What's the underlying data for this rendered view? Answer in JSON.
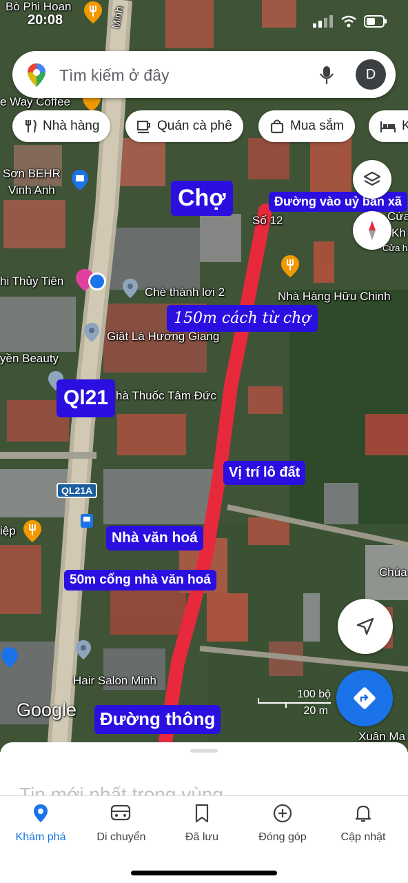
{
  "status": {
    "time": "20:08"
  },
  "search": {
    "placeholder": "Tìm kiếm ở đây",
    "avatar_letter": "D"
  },
  "chips": [
    {
      "label": "Nhà hàng",
      "icon": "fork-knife-icon"
    },
    {
      "label": "Quán cà phê",
      "icon": "coffee-cup-icon"
    },
    {
      "label": "Mua sắm",
      "icon": "shopping-bag-icon"
    },
    {
      "label": "K",
      "icon": "bed-icon"
    }
  ],
  "map_places": {
    "bo_phi_hoan": "Bò Phi Hoan",
    "way_coffee": "e Way Coffee",
    "son_behr_1": "Sơn BEHR",
    "son_behr_2": "Vinh Anh",
    "thuy_tien": "hi Thủy Tiên",
    "che_thanh_loi": "Chè thành lơi 2",
    "giat_la": "Giặt Là Hương Giang",
    "beauty": "yền Beauty",
    "nha_thuoc": "hà Thuốc Tâm Đức",
    "so_12": "Số 12",
    "cua": "Cửa",
    "kh": "Kh",
    "cua_hang": "Cửa hà",
    "nha_hang_huu_chinh": "Nhà Hàng Hữu Chinh",
    "road_ql21a": "QL21A",
    "hiep": "iệp",
    "chua": "Chùa",
    "hair_salon": "Hair Salon Minh",
    "xuan_ma": "Xuân Ma",
    "road_minh": "Minh",
    "google_logo": "Google",
    "scale_top": "100 bộ",
    "scale_bottom": "20 m"
  },
  "annotations": {
    "cho": "Chợ",
    "duong_vao": "Đường vào uỷ ban xã",
    "cach_cho": "150m cách từ chợ",
    "ql21": "Ql21",
    "vi_tri": "Vị trí lô đất",
    "nha_van_hoa": "Nhà văn hoá",
    "cong_nha_van_hoa": "50m cổng nhà văn hoá",
    "duong_thong": "Đường thông"
  },
  "sheet": {
    "title": "Tin mới nhất trong vùng"
  },
  "nav": [
    {
      "label": "Khám phá",
      "icon": "location-pin-icon",
      "active": true
    },
    {
      "label": "Di chuyển",
      "icon": "car-icon",
      "active": false
    },
    {
      "label": "Đã lưu",
      "icon": "bookmark-icon",
      "active": false
    },
    {
      "label": "Đóng góp",
      "icon": "add-circle-icon",
      "active": false
    },
    {
      "label": "Cập nhật",
      "icon": "bell-icon",
      "active": false
    }
  ],
  "colors": {
    "accent": "#1a73e8",
    "annotation_bg": "#2b0fe0",
    "route_line": "#e8293c"
  }
}
